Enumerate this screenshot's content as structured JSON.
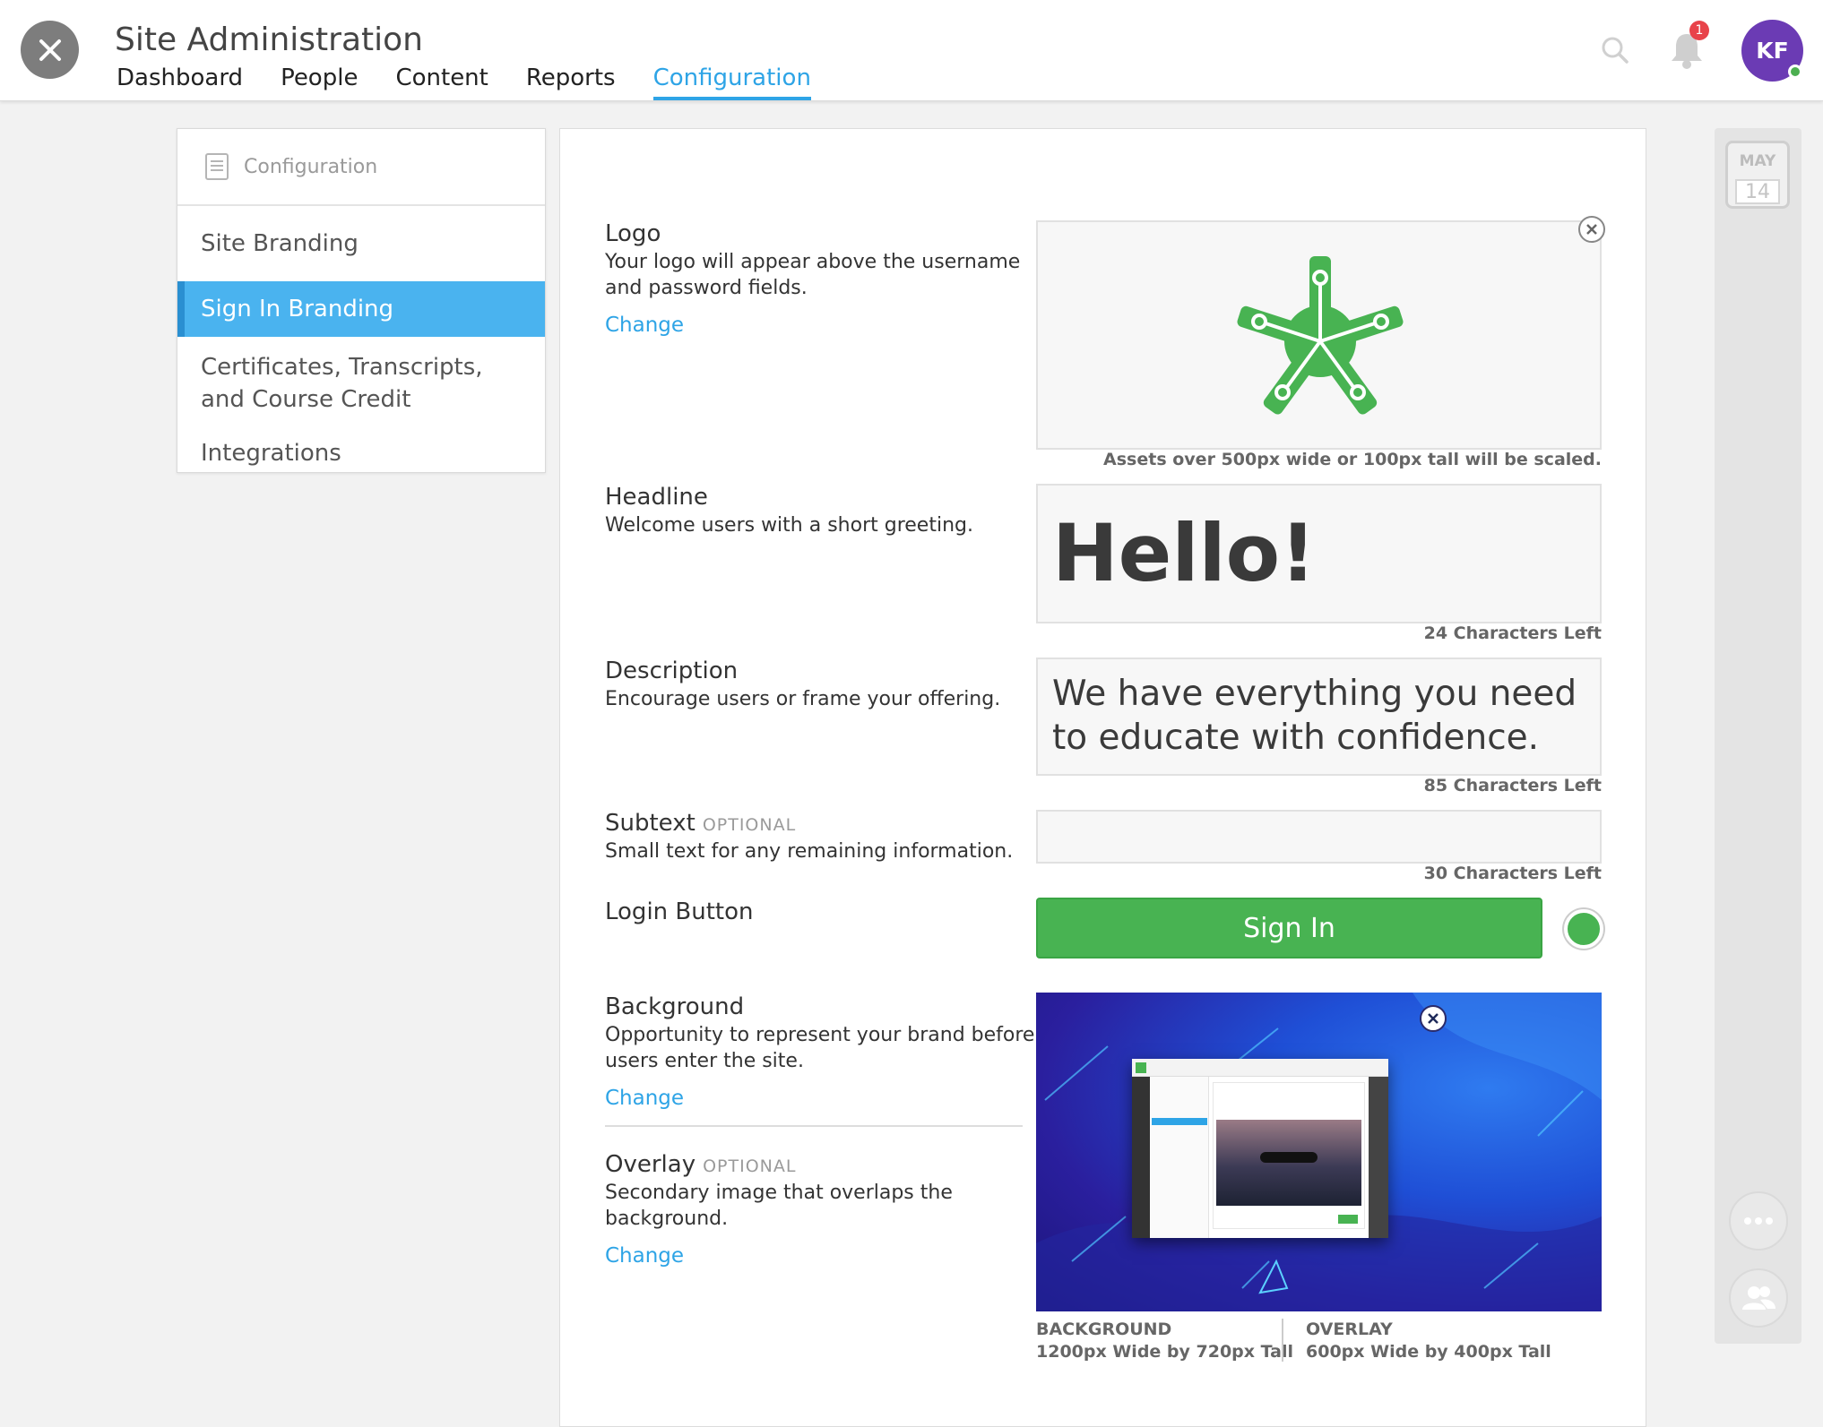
{
  "header": {
    "title": "Site Administration",
    "nav": [
      "Dashboard",
      "People",
      "Content",
      "Reports",
      "Configuration"
    ],
    "active_nav": "Configuration",
    "notification_count": "1",
    "avatar_initials": "KF"
  },
  "sidebar": {
    "heading": "Configuration",
    "items": [
      {
        "label": "Site Branding"
      },
      {
        "label": "Sign In Branding"
      },
      {
        "label": "Certificates, Transcripts,"
      },
      {
        "label": "and Course Credit"
      },
      {
        "label": "Integrations"
      }
    ],
    "active": "Sign In Branding"
  },
  "form": {
    "logo": {
      "title": "Logo",
      "desc": "Your logo will appear above the username and password fields.",
      "change": "Change",
      "hint": "Assets over 500px wide or 100px tall will be scaled."
    },
    "headline": {
      "title": "Headline",
      "desc": "Welcome users with a short greeting.",
      "value": "Hello!",
      "hint": "24 Characters Left"
    },
    "description": {
      "title": "Description",
      "desc": "Encourage users or frame your offering.",
      "value": "We have everything you need to educate with confidence.",
      "hint": "85 Characters Left"
    },
    "subtext": {
      "title": "Subtext",
      "optional": "OPTIONAL",
      "desc": "Small text for any remaining information.",
      "value": "",
      "hint": "30 Characters Left"
    },
    "login_button": {
      "title": "Login Button",
      "label": "Sign In",
      "color": "#48b352"
    },
    "background": {
      "title": "Background",
      "desc": "Opportunity to represent your brand before users enter the site.",
      "change": "Change"
    },
    "overlay": {
      "title": "Overlay",
      "optional": "OPTIONAL",
      "desc": "Secondary image that overlaps the background.",
      "change": "Change"
    },
    "media_labels": {
      "background_title": "BACKGROUND",
      "background_size": "1200px Wide by 720px Tall",
      "overlay_title": "OVERLAY",
      "overlay_size": "600px Wide by 400px Tall"
    }
  },
  "rail": {
    "calendar_month": "MAY",
    "calendar_day": "14"
  },
  "colors": {
    "accent": "#2ea4e6",
    "brand_green": "#48b352",
    "avatar": "#6b3bb4"
  }
}
